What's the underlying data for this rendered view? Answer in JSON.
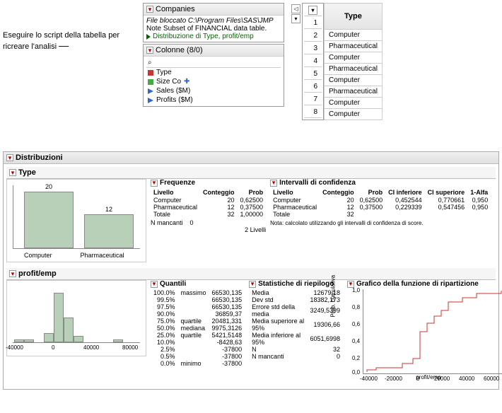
{
  "annotation": "Eseguire lo script della tabella per ricreare l'analisi",
  "companies_panel": {
    "title": "Companies",
    "file_line": "File bloccato  C:\\Program Files\\SAS\\JMP",
    "note_line": "Note  Subset of FINANCIAL data table.",
    "script_line": "Distribuzione di Type, profit/emp"
  },
  "columns_panel": {
    "title": "Colonne (8/0)",
    "search_placeholder": "",
    "items": [
      "Type",
      "Size Co",
      "Sales ($M)",
      "Profits ($M)"
    ]
  },
  "data_grid": {
    "header": "Type",
    "rows": [
      {
        "n": 1,
        "v": "Computer"
      },
      {
        "n": 2,
        "v": "Pharmaceutical"
      },
      {
        "n": 3,
        "v": "Computer"
      },
      {
        "n": 4,
        "v": "Pharmaceutical"
      },
      {
        "n": 5,
        "v": "Computer"
      },
      {
        "n": 6,
        "v": "Pharmaceutical"
      },
      {
        "n": 7,
        "v": "Computer"
      },
      {
        "n": 8,
        "v": "Computer"
      }
    ]
  },
  "distribuzioni": {
    "title": "Distribuzioni",
    "type": {
      "title": "Type",
      "freq_title": "Frequenze",
      "freq_headers": [
        "Livello",
        "Conteggio",
        "Prob"
      ],
      "freq_rows": [
        [
          "Computer",
          "20",
          "0,62500"
        ],
        [
          "Pharmaceutical",
          "12",
          "0,37500"
        ],
        [
          "Totale",
          "32",
          "1,00000"
        ]
      ],
      "n_missing_lbl": "N mancanti",
      "n_missing_val": "0",
      "levels_lbl": "2  Livelli",
      "ci_title": "Intervalli di confidenza",
      "ci_headers": [
        "Livello",
        "Conteggio",
        "Prob",
        "CI inferiore",
        "CI superiore",
        "1-Alfa"
      ],
      "ci_rows": [
        [
          "Computer",
          "20",
          "0,62500",
          "0,452544",
          "0,770661",
          "0,950"
        ],
        [
          "Pharmaceutical",
          "12",
          "0,37500",
          "0,229339",
          "0,547456",
          "0,950"
        ],
        [
          "Totale",
          "32",
          "",
          "",
          "",
          ""
        ]
      ],
      "ci_note": "Nota: calcolato utilizzando gli intervalli di confidenza di score."
    },
    "profit": {
      "title": "profit/emp",
      "quant_title": "Quantili",
      "quant_rows": [
        [
          "100.0%",
          "massimo",
          "66530,135"
        ],
        [
          "99.5%",
          "",
          "66530,135"
        ],
        [
          "97.5%",
          "",
          "66530,135"
        ],
        [
          "90.0%",
          "",
          "36859,37"
        ],
        [
          "75.0%",
          "quartile",
          "20481,331"
        ],
        [
          "50.0%",
          "mediana",
          "9975,3126"
        ],
        [
          "25.0%",
          "quartile",
          "5421,5148"
        ],
        [
          "10.0%",
          "",
          "-8428,63"
        ],
        [
          "2.5%",
          "",
          "-37800"
        ],
        [
          "0.5%",
          "",
          "-37800"
        ],
        [
          "0.0%",
          "minimo",
          "-37800"
        ]
      ],
      "summary_title": "Statistiche di riepilogo",
      "summary_rows": [
        [
          "Media",
          "12679,18"
        ],
        [
          "Dev std",
          "18382,173"
        ],
        [
          "Errore std della media",
          "3249,5399"
        ],
        [
          "Media superiore al 95%",
          "19306,66"
        ],
        [
          "Media inferiore al 95%",
          "6051,6998"
        ],
        [
          "N",
          "32"
        ],
        [
          "N mancanti",
          "0"
        ]
      ],
      "cdf_title": "Grafico della funzione di ripartizione",
      "cdf_ylabel": "Prob. cumulativa",
      "cdf_xlabel": "profit/emp"
    }
  },
  "chart_data": [
    {
      "type": "bar",
      "title": "Type",
      "categories": [
        "Computer",
        "Pharmaceutical"
      ],
      "values": [
        20,
        12
      ],
      "ylim": [
        0,
        22
      ]
    },
    {
      "type": "bar",
      "title": "profit/emp histogram",
      "categories": [
        -40000,
        -20000,
        0,
        20000,
        40000,
        60000,
        80000
      ],
      "values": [
        1,
        1,
        3,
        16,
        8,
        2,
        0,
        1
      ],
      "xlabel": "profit/emp",
      "xlim": [
        -40000,
        80000
      ]
    },
    {
      "type": "line",
      "title": "Grafico della funzione di ripartizione",
      "xlabel": "profit/emp",
      "ylabel": "Prob. cumulativa",
      "xlim": [
        -40000,
        70000
      ],
      "ylim": [
        0,
        1.0
      ],
      "x": [
        -37800,
        -30000,
        -8428,
        0,
        5421,
        9975,
        15000,
        20481,
        30000,
        36859,
        50000,
        66530
      ],
      "y": [
        0.03,
        0.06,
        0.1,
        0.18,
        0.25,
        0.5,
        0.62,
        0.75,
        0.85,
        0.9,
        0.95,
        1.0
      ]
    }
  ]
}
